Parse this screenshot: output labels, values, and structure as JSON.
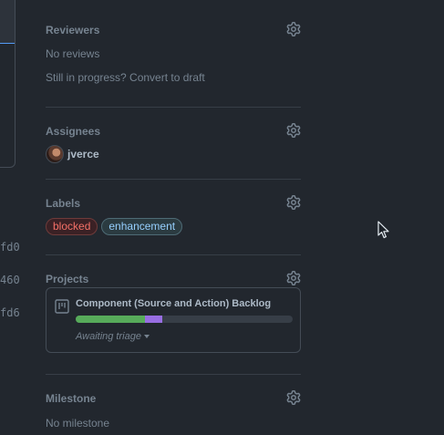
{
  "left_hashes": [
    "fd0",
    "460",
    "fd6"
  ],
  "reviewers": {
    "title": "Reviewers",
    "status": "No reviews",
    "draft_prompt": "Still in progress? Convert to draft"
  },
  "assignees": {
    "title": "Assignees",
    "items": [
      {
        "name": "jverce"
      }
    ]
  },
  "labels": {
    "title": "Labels",
    "items": [
      {
        "name": "blocked",
        "color": "#f47067"
      },
      {
        "name": "enhancement",
        "color": "#96d0ff"
      }
    ]
  },
  "projects": {
    "title": "Projects",
    "items": [
      {
        "name": "Component (Source and Action) Backlog",
        "status": "Awaiting triage",
        "progress": [
          {
            "fraction": 0.32,
            "color": "#57ab5a"
          },
          {
            "fraction": 0.08,
            "color": "#986ee2"
          }
        ]
      }
    ]
  },
  "milestone": {
    "title": "Milestone",
    "status": "No milestone"
  },
  "icons": {
    "gear": "gear-icon",
    "project": "project-board-icon",
    "cursor": "mouse-pointer-icon"
  },
  "colors": {
    "background": "#22272e",
    "muted_text": "#768390",
    "divider": "#373e47"
  }
}
